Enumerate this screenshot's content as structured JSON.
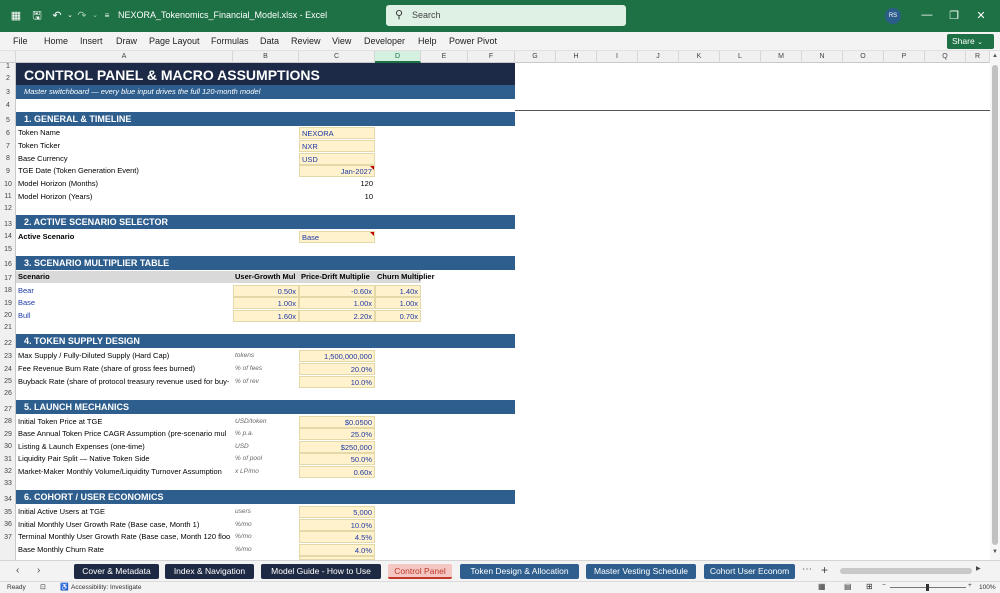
{
  "window": {
    "title": "NEXORA_Tokenomics_Financial_Model.xlsx  -  Excel",
    "search_placeholder": "Search",
    "user_initials": "RS"
  },
  "menu": [
    "File",
    "Home",
    "Insert",
    "Draw",
    "Page Layout",
    "Formulas",
    "Data",
    "Review",
    "View",
    "Developer",
    "Help",
    "Power Pivot"
  ],
  "share_label": "Share",
  "columns": [
    "A",
    "B",
    "C",
    "D",
    "E",
    "F",
    "G",
    "H",
    "I",
    "J",
    "K",
    "L",
    "M",
    "N",
    "O",
    "P",
    "Q",
    "R"
  ],
  "rows": [
    "1",
    "2",
    "3",
    "4",
    "5",
    "6",
    "7",
    "8",
    "9",
    "10",
    "11",
    "12",
    "13",
    "14",
    "15",
    "16",
    "17",
    "18",
    "19",
    "20",
    "21",
    "22",
    "23",
    "24",
    "25",
    "26",
    "27",
    "28",
    "29",
    "30",
    "31",
    "32",
    "33",
    "34",
    "35",
    "36",
    "37"
  ],
  "sheet": {
    "title": "CONTROL PANEL & MACRO ASSUMPTIONS",
    "subtitle": "Master switchboard — every blue input drives the full 120-month model",
    "s1": "1. GENERAL & TIMELINE",
    "token_name_label": "Token Name",
    "token_name": "NEXORA",
    "ticker_label": "Token Ticker",
    "ticker": "NXR",
    "currency_label": "Base Currency",
    "currency": "USD",
    "tge_label": "TGE Date (Token Generation Event)",
    "tge": "Jan-2027",
    "horizon_m_label": "Model Horizon (Months)",
    "horizon_m": "120",
    "horizon_y_label": "Model Horizon (Years)",
    "horizon_y": "10",
    "s2": "2. ACTIVE SCENARIO SELECTOR",
    "scenario_label": "Active Scenario",
    "scenario": "Base",
    "s3": "3. SCENARIO MULTIPLIER TABLE",
    "mult_headers": [
      "Scenario",
      "User-Growth Mul",
      "Price-Drift Multiplie",
      "Churn Multiplier"
    ],
    "mult_rows": [
      [
        "Bear",
        "0.50x",
        "-0.60x",
        "1.40x"
      ],
      [
        "Base",
        "1.00x",
        "1.00x",
        "1.00x"
      ],
      [
        "Bull",
        "1.60x",
        "2.20x",
        "0.70x"
      ]
    ],
    "s4": "4. TOKEN SUPPLY DESIGN",
    "max_supply_label": "Max Supply / Fully-Diluted Supply (Hard Cap)",
    "max_supply_unit": "tokens",
    "max_supply": "1,500,000,000",
    "burn_label": "Fee Revenue Burn Rate (share of gross fees burned)",
    "burn_unit": "% of fees",
    "burn": "20.0%",
    "buyback_label": "Buyback Rate (share of protocol treasury revenue used for buy-",
    "buyback_unit": "% of rev",
    "buyback": "10.0%",
    "s5": "5. LAUNCH MECHANICS",
    "price_label": "Initial Token Price at TGE",
    "price_unit": "USD/token",
    "price": "$0.0500",
    "cagr_label": "Base Annual Token Price CAGR Assumption (pre-scenario mul",
    "cagr_unit": "% p.a.",
    "cagr": "25.0%",
    "listing_label": "Listing & Launch Expenses (one-time)",
    "listing_unit": "USD",
    "listing": "$250,000",
    "liq_label": "Liquidity Pair Split — Native Token Side",
    "liq_unit": "% of pool",
    "liq": "50.0%",
    "mm_label": "Market-Maker Monthly Volume/Liquidity Turnover Assumption",
    "mm_unit": "x LP/mo",
    "mm": "0.60x",
    "s6": "6. COHORT / USER ECONOMICS",
    "users_label": "Initial Active Users at TGE",
    "users_unit": "users",
    "users": "5,000",
    "growth_label": "Initial Monthly User Growth Rate (Base case, Month 1)",
    "growth_unit": "%/mo",
    "growth": "10.0%",
    "term_label": "Terminal Monthly User Growth Rate (Base case, Month 120 floo",
    "term_unit": "%/mo",
    "term": "4.5%",
    "churn_label": "Base Monthly Churn Rate",
    "churn_unit": "%/mo",
    "churn": "4.0%"
  },
  "tabs": [
    "Cover & Metadata",
    "Index & Navigation",
    "Model Guide - How to Use",
    "Control Panel",
    "Token Design & Allocation",
    "Master Vesting Schedule",
    "Cohort User Econom"
  ],
  "status": {
    "ready": "Ready",
    "accessibility": "Accessibility: Investigate",
    "zoom": "100%"
  }
}
